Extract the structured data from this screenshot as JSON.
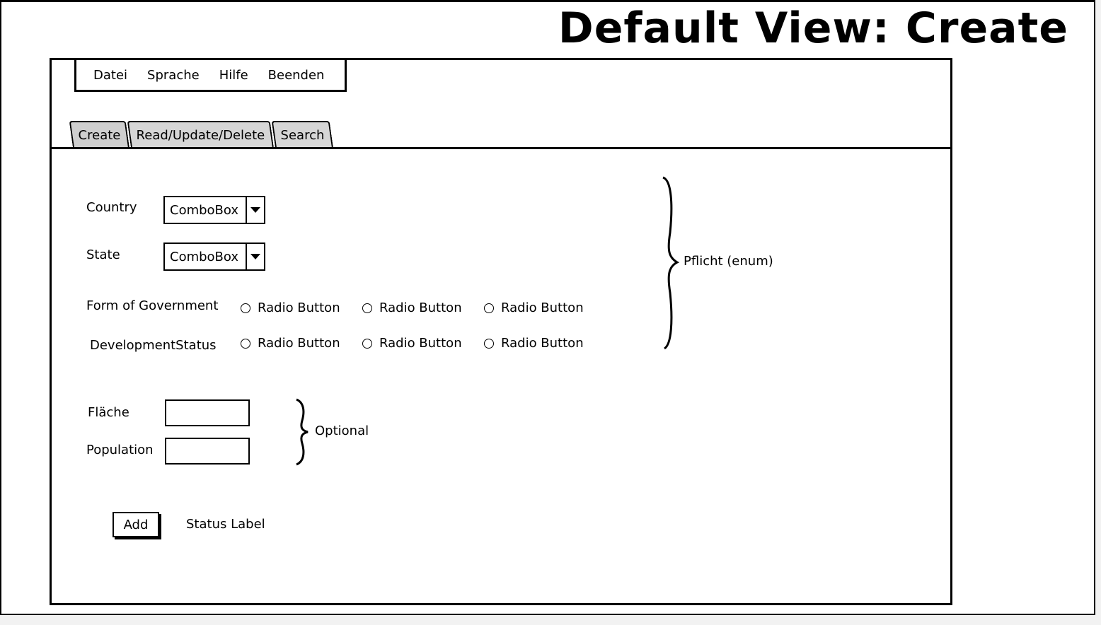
{
  "page_title": "Default View: Create",
  "menu": [
    "Datei",
    "Sprache",
    "Hilfe",
    "Beenden"
  ],
  "tabs": [
    "Create",
    "Read/Update/Delete",
    "Search"
  ],
  "form": {
    "country_label": "Country",
    "country_combo": "ComboBox",
    "state_label": "State",
    "state_combo": "ComboBox",
    "government_label": "Form of Government",
    "government_options": [
      "Radio Button",
      "Radio Button",
      "Radio Button"
    ],
    "development_label": "DevelopmentStatus",
    "development_options": [
      "Radio Button",
      "Radio Button",
      "Radio Button"
    ],
    "area_label": "Fläche",
    "area_value": "",
    "population_label": "Population",
    "population_value": "",
    "add_button": "Add",
    "status_label": "Status Label"
  },
  "annotations": {
    "required": "Pflicht (enum)",
    "optional": "Optional"
  }
}
